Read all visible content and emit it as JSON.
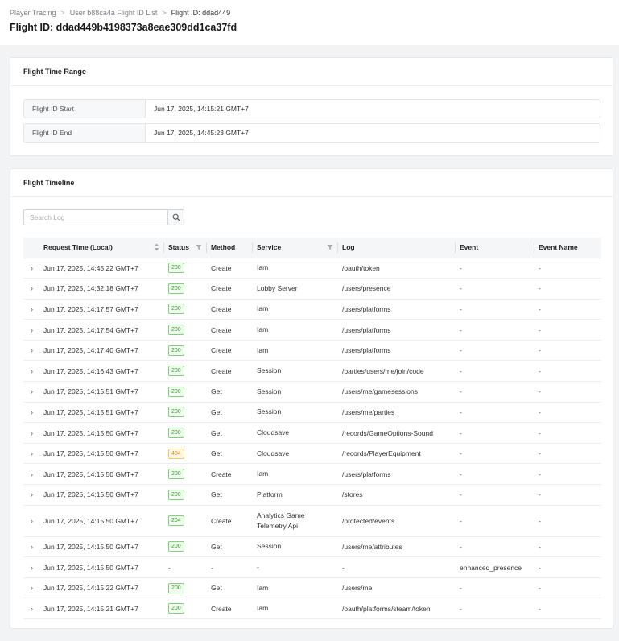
{
  "breadcrumb": {
    "items": [
      "Player Tracing",
      "User b88ca4a Flight ID List",
      "Flight ID: ddad449"
    ],
    "separator": ">"
  },
  "page_title": "Flight ID: ddad449b4198373a8eae309dd1ca37fd",
  "time_range": {
    "title": "Flight Time Range",
    "start_label": "Flight ID Start",
    "start_value": "Jun 17, 2025, 14:15:21 GMT+7",
    "end_label": "Flight ID End",
    "end_value": "Jun 17, 2025, 14:45:23 GMT+7"
  },
  "timeline": {
    "title": "Flight Timeline",
    "search_placeholder": "Search Log",
    "columns": [
      "Request Time (Local)",
      "Status",
      "Method",
      "Service",
      "Log",
      "Event",
      "Event Name"
    ],
    "rows": [
      {
        "time": "Jun 17, 2025, 14:45:22 GMT+7",
        "status": "200",
        "method": "Create",
        "service": "Iam",
        "log": "/oauth/token",
        "event": "-",
        "event_name": "-"
      },
      {
        "time": "Jun 17, 2025, 14:32:18 GMT+7",
        "status": "200",
        "method": "Create",
        "service": "Lobby Server",
        "log": "/users/presence",
        "event": "-",
        "event_name": "-"
      },
      {
        "time": "Jun 17, 2025, 14:17:57 GMT+7",
        "status": "200",
        "method": "Create",
        "service": "Iam",
        "log": "/users/platforms",
        "event": "-",
        "event_name": "-"
      },
      {
        "time": "Jun 17, 2025, 14:17:54 GMT+7",
        "status": "200",
        "method": "Create",
        "service": "Iam",
        "log": "/users/platforms",
        "event": "-",
        "event_name": "-"
      },
      {
        "time": "Jun 17, 2025, 14:17:40 GMT+7",
        "status": "200",
        "method": "Create",
        "service": "Iam",
        "log": "/users/platforms",
        "event": "-",
        "event_name": "-"
      },
      {
        "time": "Jun 17, 2025, 14:16:43 GMT+7",
        "status": "200",
        "method": "Create",
        "service": "Session",
        "log": "/parties/users/me/join/code",
        "event": "-",
        "event_name": "-"
      },
      {
        "time": "Jun 17, 2025, 14:15:51 GMT+7",
        "status": "200",
        "method": "Get",
        "service": "Session",
        "log": "/users/me/gamesessions",
        "event": "-",
        "event_name": "-"
      },
      {
        "time": "Jun 17, 2025, 14:15:51 GMT+7",
        "status": "200",
        "method": "Get",
        "service": "Session",
        "log": "/users/me/parties",
        "event": "-",
        "event_name": "-"
      },
      {
        "time": "Jun 17, 2025, 14:15:50 GMT+7",
        "status": "200",
        "method": "Get",
        "service": "Cloudsave",
        "log": "/records/GameOptions-Sound",
        "event": "-",
        "event_name": "-"
      },
      {
        "time": "Jun 17, 2025, 14:15:50 GMT+7",
        "status": "404",
        "method": "Get",
        "service": "Cloudsave",
        "log": "/records/PlayerEquipment",
        "event": "-",
        "event_name": "-"
      },
      {
        "time": "Jun 17, 2025, 14:15:50 GMT+7",
        "status": "200",
        "method": "Create",
        "service": "Iam",
        "log": "/users/platforms",
        "event": "-",
        "event_name": "-"
      },
      {
        "time": "Jun 17, 2025, 14:15:50 GMT+7",
        "status": "200",
        "method": "Get",
        "service": "Platform",
        "log": "/stores",
        "event": "-",
        "event_name": "-"
      },
      {
        "time": "Jun 17, 2025, 14:15:50 GMT+7",
        "status": "204",
        "method": "Create",
        "service": "Analytics Game Telemetry Api",
        "log": "/protected/events",
        "event": "-",
        "event_name": "-"
      },
      {
        "time": "Jun 17, 2025, 14:15:50 GMT+7",
        "status": "200",
        "method": "Get",
        "service": "Session",
        "log": "/users/me/attributes",
        "event": "-",
        "event_name": "-"
      },
      {
        "time": "Jun 17, 2025, 14:15:50 GMT+7",
        "status": "-",
        "method": "-",
        "service": "-",
        "log": "-",
        "event": "enhanced_presence",
        "event_name": "-"
      },
      {
        "time": "Jun 17, 2025, 14:15:22 GMT+7",
        "status": "200",
        "method": "Get",
        "service": "Iam",
        "log": "/users/me",
        "event": "-",
        "event_name": "-"
      },
      {
        "time": "Jun 17, 2025, 14:15:21 GMT+7",
        "status": "200",
        "method": "Create",
        "service": "Iam",
        "log": "/oauth/platforms/steam/token",
        "event": "-",
        "event_name": "-"
      }
    ]
  },
  "colors": {
    "status_ok": "#3d9b36",
    "status_warn": "#d48a0b",
    "page_bg": "#f2f3f5"
  }
}
